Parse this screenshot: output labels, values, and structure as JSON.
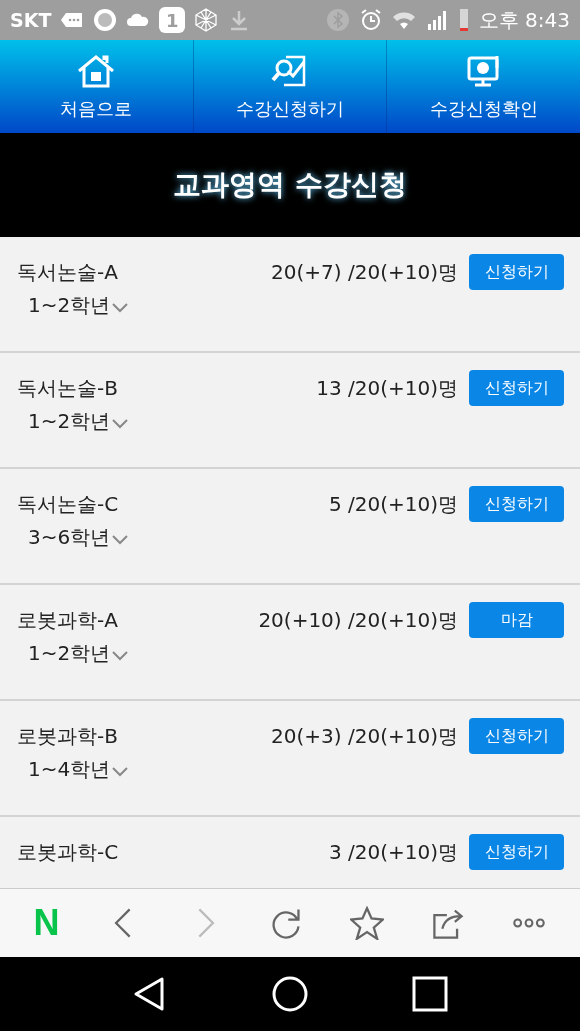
{
  "status_bar": {
    "carrier": "SKT",
    "app_badge": "1",
    "time": "오후 8:43"
  },
  "nav": [
    {
      "label": "처음으로"
    },
    {
      "label": "수강신청하기"
    },
    {
      "label": "수강신청확인"
    }
  ],
  "title": "교과영역 수강신청",
  "courses": [
    {
      "name": "독서논술-A",
      "grade": "1~2학년",
      "count": "20(+7) /20(+10)명",
      "button": "신청하기"
    },
    {
      "name": "독서논술-B",
      "grade": "1~2학년",
      "count": "13 /20(+10)명",
      "button": "신청하기"
    },
    {
      "name": "독서논술-C",
      "grade": "3~6학년",
      "count": "5 /20(+10)명",
      "button": "신청하기"
    },
    {
      "name": "로봇과학-A",
      "grade": "1~2학년",
      "count": "20(+10) /20(+10)명",
      "button": "마감"
    },
    {
      "name": "로봇과학-B",
      "grade": "1~4학년",
      "count": "20(+3) /20(+10)명",
      "button": "신청하기"
    },
    {
      "name": "로봇과학-C",
      "count": "3 /20(+10)명",
      "button": "신청하기"
    }
  ],
  "toolbar": {
    "logo": "N",
    "items": [
      {
        "kind": "back",
        "disabled": false
      },
      {
        "kind": "forward",
        "disabled": true
      },
      {
        "kind": "reload",
        "disabled": false
      },
      {
        "kind": "star",
        "disabled": false
      },
      {
        "kind": "share",
        "disabled": false
      },
      {
        "kind": "more",
        "disabled": false
      }
    ]
  }
}
